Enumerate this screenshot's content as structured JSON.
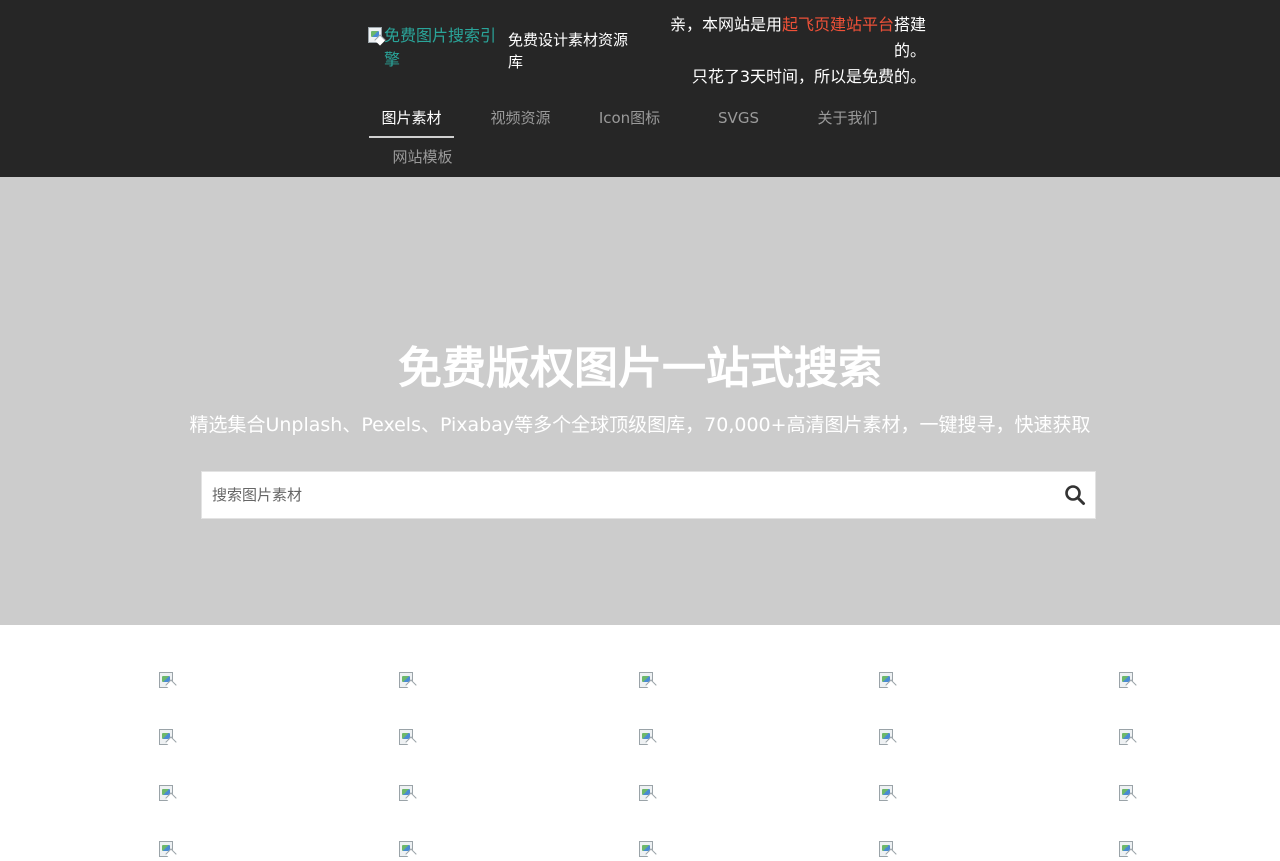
{
  "header": {
    "logo_alt": "免费图片搜索引擎",
    "site_subtitle": "免费设计素材资源库",
    "notice": {
      "prefix": "亲，本网站是用",
      "link_text": "起飞页建站平台",
      "suffix": "搭建的。",
      "line2": "只花了3天时间，所以是免费的。"
    },
    "link_color": "#ef5138",
    "logo_color": "#2aa59a"
  },
  "nav": {
    "items": [
      {
        "label": "图片素材",
        "active": true
      },
      {
        "label": "视频资源",
        "active": false
      },
      {
        "label": "Icon图标",
        "active": false
      },
      {
        "label": "SVGS",
        "active": false
      },
      {
        "label": "关于我们",
        "active": false
      },
      {
        "label": "网站模板",
        "active": false
      }
    ]
  },
  "hero": {
    "title": "免费版权图片一站式搜索",
    "subtitle": "精选集合Unplash、Pexels、Pixabay等多个全球顶级图库，70,000+高清图片素材，一键搜寻，快速获取",
    "search_placeholder": "搜索图片素材",
    "search_icon": "search-icon",
    "background": "#cccccc"
  },
  "gallery": {
    "columns": 5,
    "rows": 4,
    "item_icon": "broken-image-icon"
  }
}
